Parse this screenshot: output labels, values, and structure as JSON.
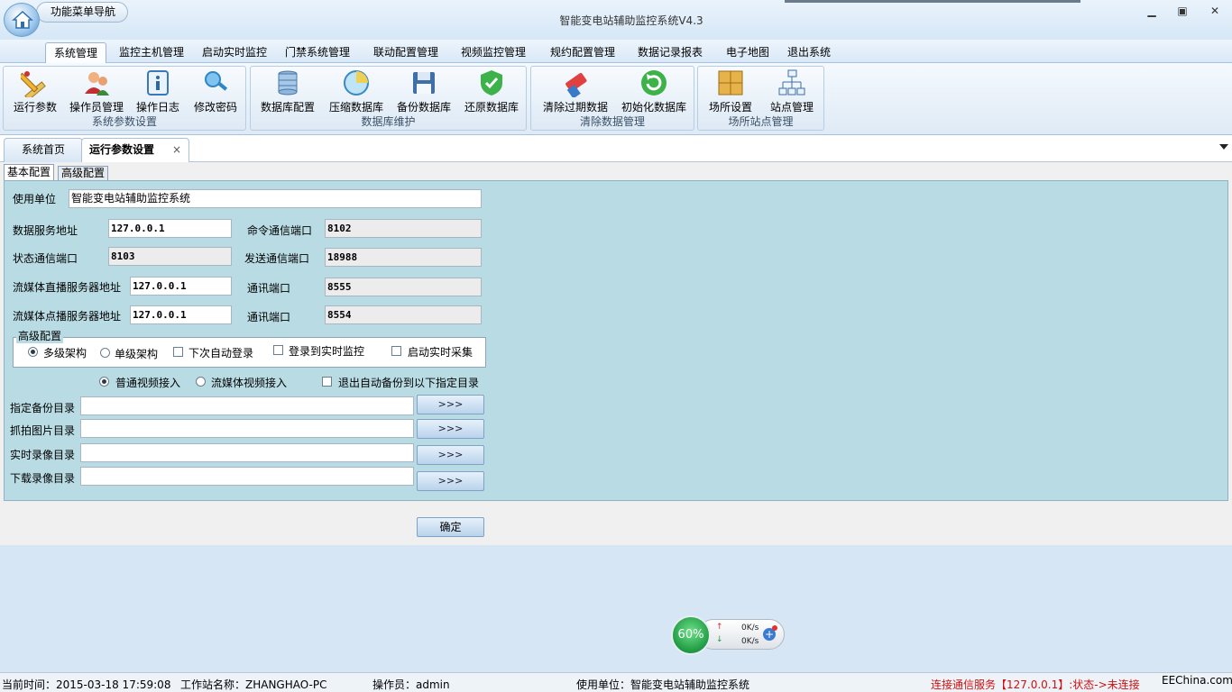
{
  "titlebar": {
    "menu_nav": "功能菜单导航",
    "app_title": "智能变电站辅助监控系统V4.3",
    "minimize": "▁",
    "maximize": "▣",
    "close": "✕"
  },
  "menu": {
    "tabs": [
      "系统管理",
      "监控主机管理",
      "启动实时监控",
      "门禁系统管理",
      "联动配置管理",
      "视频监控管理",
      "规约配置管理",
      "数据记录报表",
      "电子地图",
      "退出系统"
    ]
  },
  "ribbon": {
    "groups": [
      {
        "label": "系统参数设置",
        "buttons": [
          "运行参数",
          "操作员管理",
          "操作日志",
          "修改密码"
        ]
      },
      {
        "label": "数据库维护",
        "buttons": [
          "数据库配置",
          "压缩数据库",
          "备份数据库",
          "还原数据库"
        ]
      },
      {
        "label": "清除数据管理",
        "buttons": [
          "清除过期数据",
          "初始化数据库"
        ]
      },
      {
        "label": "场所站点管理",
        "buttons": [
          "场所设置",
          "站点管理"
        ]
      }
    ]
  },
  "doc_tabs": {
    "home": "系统首页",
    "active": "运行参数设置",
    "close": "×"
  },
  "sub_tabs": {
    "basic": "基本配置",
    "advanced": "高级配置"
  },
  "form": {
    "unit_label": "使用单位",
    "unit_value": "智能变电站辅助监控系统",
    "data_server_label": "数据服务地址",
    "data_server_value": "127.0.0.1",
    "cmd_port_label": "命令通信端口",
    "cmd_port_value": "8102",
    "status_port_label": "状态通信端口",
    "status_port_value": "8103",
    "send_port_label": "发送通信端口",
    "send_port_value": "18988",
    "live_server_label": "流媒体直播服务器地址",
    "live_server_value": "127.0.0.1",
    "live_port_label": "通讯端口",
    "live_port_value": "8555",
    "vod_server_label": "流媒体点播服务器地址",
    "vod_server_value": "127.0.0.1",
    "vod_port_label": "通讯端口",
    "vod_port_value": "8554",
    "advanced_group_title": "高级配置",
    "multi_arch": "多级架构",
    "single_arch": "单级架构",
    "auto_login": "下次自动登录",
    "login_to_monitor": "登录到实时监控",
    "start_collect": "启动实时采集",
    "normal_video": "普通视频接入",
    "stream_video": "流媒体视频接入",
    "exit_backup": "退出自动备份到以下指定目录",
    "backup_dir_label": "指定备份目录",
    "snapshot_dir_label": "抓拍图片目录",
    "record_dir_label": "实时录像目录",
    "download_dir_label": "下载录像目录",
    "browse": ">>>",
    "ok": "确定"
  },
  "net_widget": {
    "percent": "60%",
    "up": "0K/s",
    "down": "0K/s"
  },
  "statusbar": {
    "time": "当前时间：2015-03-18 17:59:08",
    "workstation": "工作站名称：ZHANGHAO-PC",
    "operator": "操作员：admin",
    "unit": "使用单位：智能变电站辅助监控系统",
    "connection": "连接通信服务【127.0.0.1】:状态->未连接",
    "watermark": "EEChina.com"
  },
  "colors": {
    "panel": "#b9dbe4",
    "accent": "#4f8fcc",
    "error": "#d01010"
  }
}
